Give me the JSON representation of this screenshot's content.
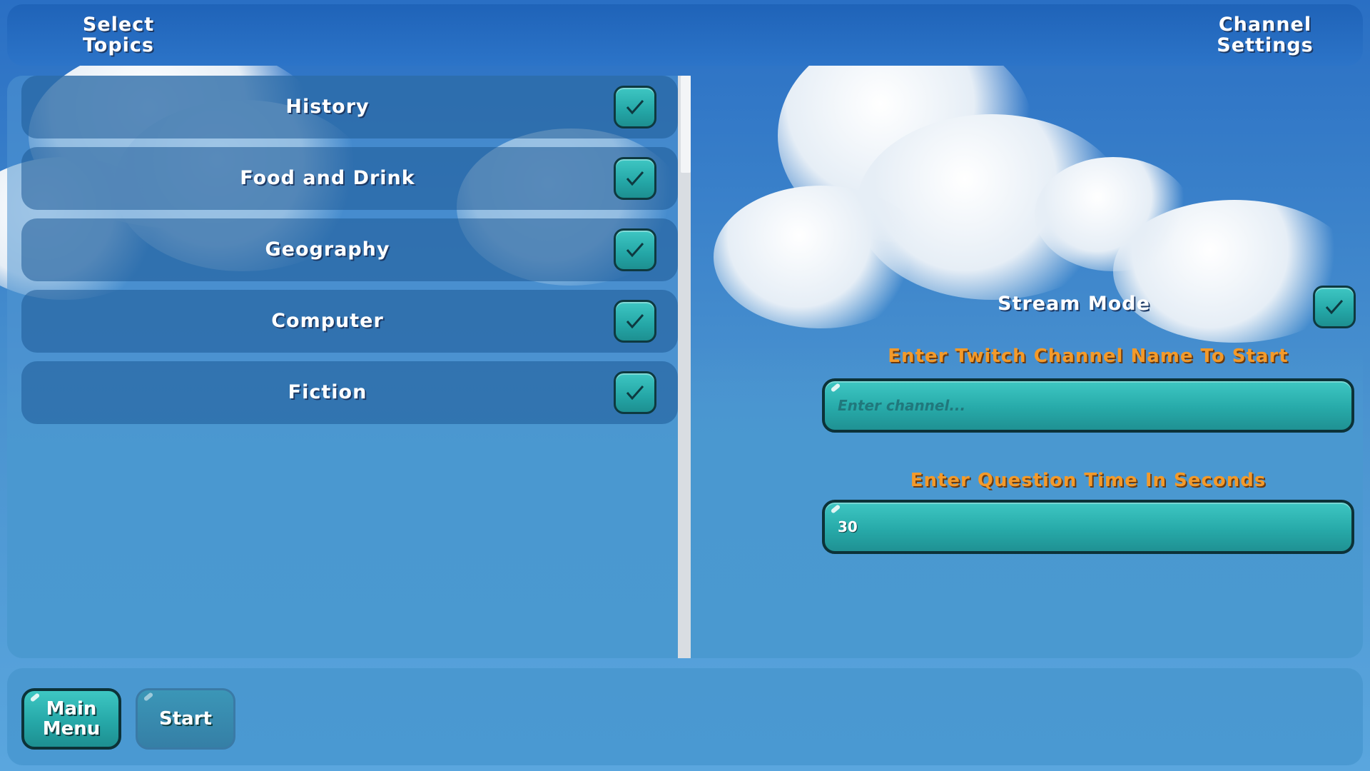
{
  "header": {
    "left_title": "Select\nTopics",
    "right_title": "Channel\nSettings"
  },
  "topics": [
    {
      "label": "History",
      "checked": true
    },
    {
      "label": "Food and Drink",
      "checked": true
    },
    {
      "label": "Geography",
      "checked": true
    },
    {
      "label": "Computer",
      "checked": true
    },
    {
      "label": "Fiction",
      "checked": true
    }
  ],
  "settings": {
    "stream_mode_label": "Stream Mode",
    "stream_mode_checked": true,
    "channel_prompt": "Enter Twitch Channel Name To Start",
    "channel_placeholder": "Enter channel...",
    "channel_value": "",
    "time_prompt": "Enter Question Time In Seconds",
    "time_value": "30"
  },
  "footer": {
    "main_menu_label": "Main\nMenu",
    "start_label": "Start"
  },
  "colors": {
    "accent_teal": "#27aaa9",
    "label_orange": "#f39a2a",
    "panel_blue": "#4a99d0"
  }
}
